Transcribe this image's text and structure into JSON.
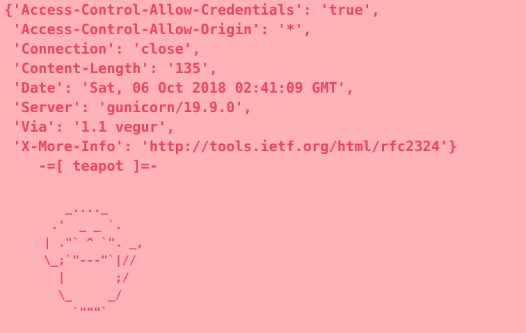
{
  "colors": {
    "background": "#ffb3b8",
    "text": "#e8455e"
  },
  "headers": [
    "{'Access-Control-Allow-Credentials': 'true',",
    " 'Access-Control-Allow-Origin': '*',",
    " 'Connection': 'close',",
    " 'Content-Length': '135',",
    " 'Date': 'Sat, 06 Oct 2018 02:41:09 GMT',",
    " 'Server': 'gunicorn/19.9.0',",
    " 'Via': '1.1 vegur',",
    " 'X-More-Info': 'http://tools.ietf.org/html/rfc2324'}"
  ],
  "teapot_title": "    -=[ teapot ]=-",
  "teapot_art": [
    "   _...._",
    " .'  _ _ `.",
    "| .\"` ^ `\". _,",
    "\\_;`\"---\"`|//",
    "  |       ;/",
    "  \\_     _/",
    "    `\"\"\"`"
  ]
}
